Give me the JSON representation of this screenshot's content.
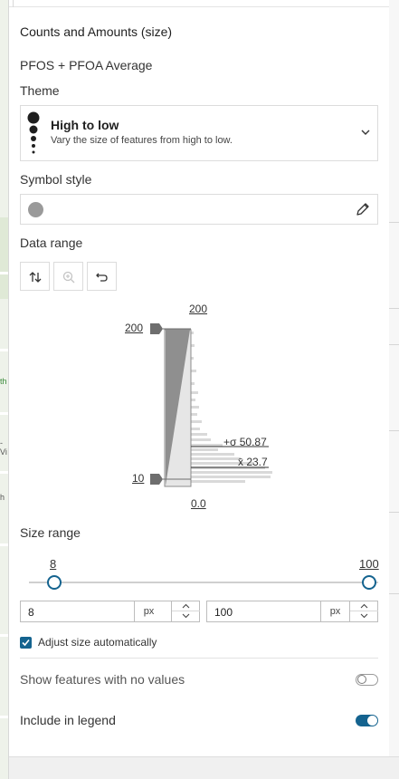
{
  "map": {
    "label_th": "th",
    "label_vi": "-Vi",
    "label_h": "h"
  },
  "panel": {
    "section_title": "Counts and Amounts (size)",
    "field_name": "PFOS + PFOA Average",
    "theme": {
      "label": "Theme",
      "title": "High to low",
      "description": "Vary the size of features from high to low."
    },
    "symbol_style": {
      "label": "Symbol style"
    },
    "data_range": {
      "label": "Data range",
      "histogram": {
        "max_handle": "200",
        "min_handle": "10",
        "top_value": "200",
        "bottom_value": "0.0",
        "stddev_label": "+σ 50.87",
        "mean_label": "x̄ 23.7"
      }
    },
    "size_range": {
      "label": "Size range",
      "min_label": "8",
      "max_label": "100",
      "min_input": "8",
      "max_input": "100",
      "unit": "px"
    },
    "adjust_size": {
      "label": "Adjust size automatically",
      "checked": true
    },
    "no_values": {
      "label": "Show features with no values",
      "on": false
    },
    "legend": {
      "label": "Include in legend",
      "on": true
    }
  },
  "colors": {
    "accent": "#14638f",
    "symbol": "#9a9a9a"
  }
}
